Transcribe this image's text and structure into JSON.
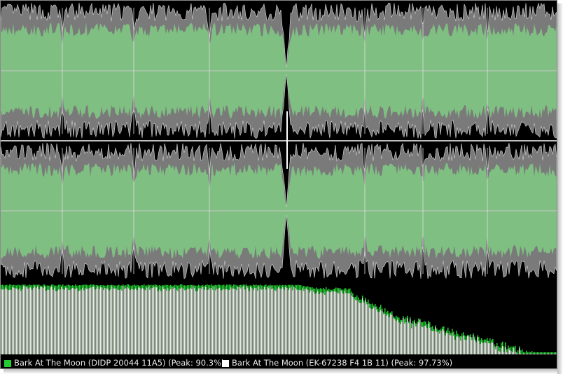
{
  "colors": {
    "background": "#000000",
    "track_a": "#7fbf82",
    "track_b": "#7a7a7a",
    "track_b_outline": "#d8d8d8",
    "zero_line": "#c8c8c8",
    "divider": "#ffffff",
    "spectrum_a": "#22cc33",
    "spectrum_b": "#e4f2e2"
  },
  "legend": {
    "items": [
      {
        "label": "Bark At The Moon (DIDP 20044 11A5) (Peak: 90.3%)",
        "color": "#22cc33",
        "icon": "green-square-icon"
      },
      {
        "label": "Bark At The Moon (EK-67238 F4 1B 11) (Peak: 97.73%)",
        "color": "#ffffff",
        "icon": "white-square-icon"
      }
    ]
  }
}
